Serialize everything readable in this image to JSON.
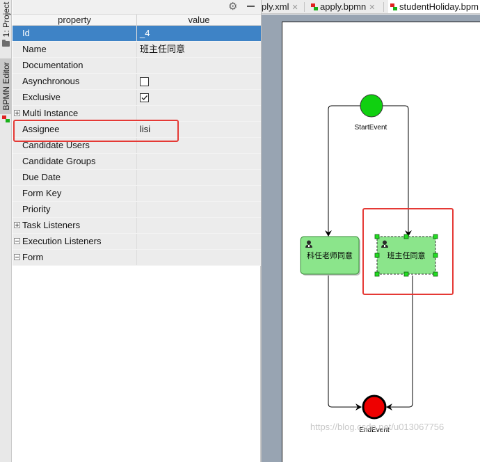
{
  "sidebar": {
    "project_tab": "1: Project",
    "bpmn_tab": "BPMN Editor"
  },
  "properties": {
    "headers": {
      "property": "property",
      "value": "value"
    },
    "rows": [
      {
        "name": "Id",
        "value": "_4",
        "selected": true
      },
      {
        "name": "Name",
        "value": "班主任同意"
      },
      {
        "name": "Documentation",
        "value": ""
      },
      {
        "name": "Asynchronous",
        "value": "",
        "checkbox": false
      },
      {
        "name": "Exclusive",
        "value": "",
        "checkbox": true
      },
      {
        "name": "Multi Instance",
        "value": "",
        "expandable": true
      },
      {
        "name": "Assignee",
        "value": "lisi"
      },
      {
        "name": "Candidate Users",
        "value": ""
      },
      {
        "name": "Candidate Groups",
        "value": ""
      },
      {
        "name": "Due Date",
        "value": ""
      },
      {
        "name": "Form Key",
        "value": ""
      },
      {
        "name": "Priority",
        "value": ""
      },
      {
        "name": "Task Listeners",
        "value": "",
        "expandable": true
      },
      {
        "name": "Execution Listeners",
        "value": "",
        "expandable": true,
        "expanded": true
      },
      {
        "name": "Form",
        "value": "",
        "expandable": true,
        "expanded": true
      }
    ]
  },
  "editor_tabs": [
    {
      "label": "ply.xml"
    },
    {
      "label": "apply.bpmn"
    },
    {
      "label": "studentHoliday.bpm",
      "active": true
    }
  ],
  "diagram": {
    "start_event": "StartEvent",
    "end_event": "EndEvent",
    "task_left": "科任老师同意",
    "task_right": "班主任同意"
  },
  "watermark": "https://blog.csdn.net/u013067756",
  "colors": {
    "selection": "#3e83c6",
    "highlight": "#e53935",
    "start_event": "#10d010",
    "end_event": "#ee0000",
    "task_fill": "#8be58b"
  }
}
